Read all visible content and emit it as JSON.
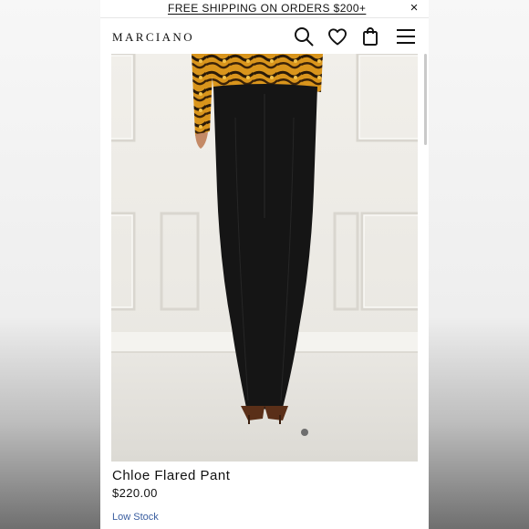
{
  "promo": {
    "text": "FREE SHIPPING ON ORDERS $200+",
    "close_label": "×"
  },
  "header": {
    "brand": "MARCIANO",
    "icons": [
      "search-icon",
      "heart-icon",
      "shopping-bag-icon",
      "menu-icon"
    ]
  },
  "product": {
    "name": "Chloe Flared Pant",
    "price": "$220.00",
    "stock": "Low Stock",
    "carousel": {
      "current_slide": 1
    }
  },
  "colors": {
    "stock_text": "#3a5ea0",
    "pant": "#151515",
    "background_panel": "#eeece7"
  }
}
